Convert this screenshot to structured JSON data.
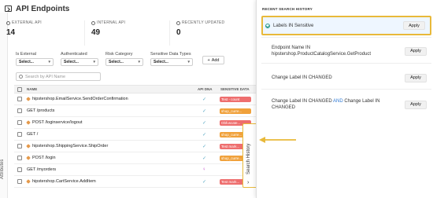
{
  "header": {
    "title": "API Endpoints"
  },
  "stats": [
    {
      "label": "EXTERNAL API",
      "value": "14"
    },
    {
      "label": "INTERNAL API",
      "value": "49"
    },
    {
      "label": "RECENTLY UPDATED",
      "value": "0"
    }
  ],
  "filters": [
    {
      "label": "Is External",
      "value": "Select..."
    },
    {
      "label": "Authenticated",
      "value": "Select..."
    },
    {
      "label": "Risk Category",
      "value": "Select..."
    },
    {
      "label": "Sensitive Data Types",
      "value": "Select..."
    }
  ],
  "add_label": "Add",
  "search": {
    "placeholder": "Search by API Name"
  },
  "table": {
    "headers": {
      "name": "NAME",
      "api_dna": "API DNA",
      "sensitive": "SENSITIVE DATA"
    },
    "rows": [
      {
        "name": "hipstershop.EmailService.SendOrderConfirmation",
        "dot": true,
        "api": "✓",
        "tag": "Test - count",
        "tag_color": "red"
      },
      {
        "name": "GET /products",
        "dot": false,
        "api": "✓",
        "tag": "shop_curre...",
        "tag_color": "orange"
      },
      {
        "name": "POST /loginservice/logout",
        "dot": true,
        "api": "✓",
        "tag": "Obfuscate...",
        "tag_color": "red"
      },
      {
        "name": "GET /",
        "dot": false,
        "api": "✓",
        "tag": "shop_curre...",
        "tag_color": "orange"
      },
      {
        "name": "hipstershop.ShippingService.ShipOrder",
        "dot": true,
        "api": "✓",
        "tag": "Test mark...",
        "tag_color": "red"
      },
      {
        "name": "POST /login",
        "dot": true,
        "api": "✓",
        "tag": "shop_curre...",
        "tag_color": "orange"
      },
      {
        "name": "GET /myorders",
        "dot": false,
        "api": "♀",
        "tag": "",
        "tag_color": ""
      },
      {
        "name": "hipstershop.CartService.AddItem",
        "dot": true,
        "api": "✓",
        "tag": "Test mark...",
        "tag_color": "red"
      }
    ]
  },
  "side_tab": {
    "label": "Search History",
    "chevron": "›"
  },
  "left_strip_label": "Attributes",
  "panel": {
    "title": "RECENT SEARCH HISTORY",
    "apply_label": "Apply",
    "items": [
      {
        "text": "Labels IN Sensitive"
      },
      {
        "text": "Endpoint Name IN hipstershop.ProductCatalogService.GetProduct"
      },
      {
        "text": "Change Label IN CHANGED"
      },
      {
        "text_a": "Change Label IN CHANGED",
        "and": "AND",
        "text_b": "Change Label IN CHANGED"
      }
    ]
  },
  "colors": {
    "highlight": "#e8b93a",
    "selected_bg": "#eef6ff",
    "tag_red": "#ee6e6e",
    "tag_orange": "#f0a13b"
  }
}
